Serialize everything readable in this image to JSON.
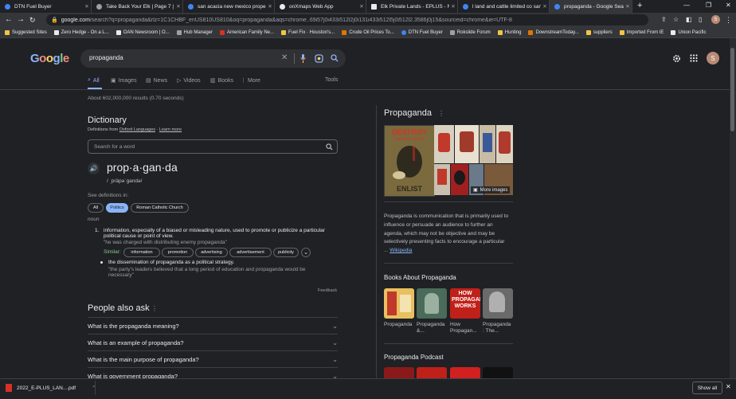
{
  "tabs": [
    {
      "title": "DTN Fuel Buyer",
      "color": "#4285f4",
      "active": false
    },
    {
      "title": "Take Back Your Elk | Page 7 | Hu",
      "color": "#9aa0a6",
      "active": false
    },
    {
      "title": "san acacia new mexico property",
      "color": "#4285f4",
      "active": false
    },
    {
      "title": "onXmaps Web App",
      "color": "#202124",
      "active": false
    },
    {
      "title": "Elk Private Lands - EPLUS - New",
      "color": "#e8eaed",
      "active": false
    },
    {
      "title": "l land and cattle limited co san",
      "color": "#4285f4",
      "active": false
    },
    {
      "title": "propaganda - Google Search",
      "color": "#4285f4",
      "active": true
    }
  ],
  "omnibox": {
    "host": "google.com",
    "path": "/search?q=propaganda&rlz=1C1CHBF_enUS810US810&oq=propaganda&aqs=chrome..69i57j0i433i512l2j0i131i433i512l5j0i512l2.3586j0j15&sourceid=chrome&ie=UTF-8"
  },
  "bookmarks": [
    "Suggested Sites",
    "Zero Hedge - On a L...",
    "OAN Newsroom | O...",
    "Hub Manager",
    "American Family Ne...",
    "Fuel Fix · Houston's...",
    "Crude Oil Prices To...",
    "DTN Fuel Buyer",
    "Rokslide Forum",
    "Hunting",
    "DownstreamToday...",
    "suppliers",
    "Imported From IE",
    "Union Pacific"
  ],
  "search": {
    "query": "propaganda",
    "avatar": "S"
  },
  "nav_tabs": [
    "All",
    "Images",
    "News",
    "Videos",
    "Books",
    "More"
  ],
  "tools_label": "Tools",
  "result_stats": "About 602,000,000 results (0.70 seconds)",
  "dictionary": {
    "title": "Dictionary",
    "source": "Definitions from",
    "source_link": "Oxford Languages",
    "learn_more": "Learn more",
    "search_placeholder": "Search for a word",
    "headword": "prop·a·gan·da",
    "pronunciation": "/ ˌpräpəˈɡandə/",
    "see_defs": "See definitions in:",
    "filters": [
      "All",
      "Politics",
      "Roman Catholic Church"
    ],
    "pos": "noun",
    "def1_num": "1.",
    "def1": "information, especially of a biased or misleading nature, used to promote or publicize a particular political cause or point of view.",
    "ex1": "\"he was charged with distributing enemy propaganda\"",
    "similar_label": "Similar:",
    "similar": [
      "information",
      "promotion",
      "advertising",
      "advertisement",
      "publicity"
    ],
    "def2": "the dissemination of propaganda as a political strategy.",
    "ex2": "\"the party's leaders believed that a long period of education and propaganda would be necessary\"",
    "feedback": "Feedback"
  },
  "paa": {
    "title": "People also ask",
    "questions": [
      "What is the propaganda meaning?",
      "What is an example of propaganda?",
      "What is the main purpose of propaganda?",
      "What is government propaganda?"
    ]
  },
  "kp": {
    "title": "Propaganda",
    "more_images": "More images",
    "poster_text_top": "DESTROY",
    "poster_text_mid": "THIS MAD BRUTE",
    "poster_text_bottom": "ENLIST",
    "description": "Propaganda is communication that is primarily used to influence or persuade an audience to further an agenda, which may not be objective and may be selectively presenting facts to encourage a particular",
    "wiki": "Wikipedia",
    "books_title": "Books About Propaganda",
    "books": [
      {
        "l1": "Propaganda",
        "l2": ""
      },
      {
        "l1": "Propaganda",
        "l2": "&..."
      },
      {
        "l1": "How",
        "l2": "Propagan..."
      },
      {
        "l1": "Propaganda",
        "l2": ": The..."
      }
    ],
    "book_cover_text": "HOW PROPAGANDA WORKS",
    "podcast_title": "Propaganda Podcast"
  },
  "download": {
    "filename": "2022_E-PLUS_LAN....pdf",
    "show_all": "Show all"
  },
  "colors": {
    "accent": "#8ab4f8",
    "bg": "#202124",
    "surface": "#303134"
  }
}
